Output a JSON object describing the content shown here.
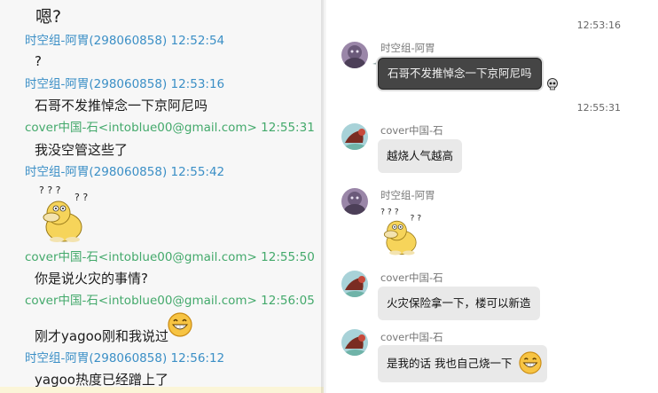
{
  "left_log": {
    "top_fragment": "嗯?",
    "entries": [
      {
        "header": "时空组-阿胃(298060858) 12:52:54",
        "text": "?"
      },
      {
        "header": "时空组-阿胃(298060858) 12:53:16",
        "text": "石哥不发推悼念一下京阿尼吗"
      },
      {
        "header": "cover中国-石<intoblue00@gmail.com> 12:55:31",
        "text": "我没空管这些了"
      },
      {
        "header": "时空组-阿胃(298060858) 12:55:42",
        "sticker": "psyduck-confused-sticker"
      },
      {
        "header": "cover中国-石<intoblue00@gmail.com> 12:55:50",
        "text": "你是说火灾的事情?"
      },
      {
        "header": "cover中国-石<intoblue00@gmail.com> 12:56:05",
        "text": "刚才yagoo刚和我说过",
        "emoji": "grin-emoji"
      },
      {
        "header": "时空组-阿胃(298060858) 12:56:12",
        "text": "yagoo热度已经蹭上了"
      }
    ]
  },
  "right_chat": {
    "timestamps": [
      "12:53:16",
      "12:55:31"
    ],
    "messages": [
      {
        "sender": "时空组-阿胃",
        "text": "石哥不发推悼念一下京阿尼吗"
      },
      {
        "sender": "cover中国-石",
        "text": "越烧人气越高"
      },
      {
        "sender": "时空组-阿胃",
        "sticker": "psyduck-confused-sticker"
      },
      {
        "sender": "cover中国-石",
        "text": "火灾保险拿一下，楼可以新造"
      },
      {
        "sender": "cover中国-石",
        "text": "是我的话 我也自己烧一下",
        "emoji": "grin-emoji"
      }
    ]
  },
  "colors": {
    "header_blue": "#3b8fc6",
    "header_green": "#43a96b",
    "bubble_grey": "#e9e9e9",
    "bubble_dark": "#454545"
  }
}
